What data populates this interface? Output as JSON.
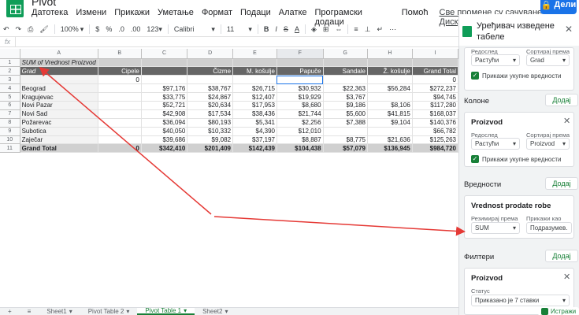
{
  "app": {
    "title": "Pivot",
    "share_label": "Дели",
    "save_status": "Све промене су сачуване на Диску"
  },
  "menu": [
    "Датотека",
    "Измени",
    "Прикажи",
    "Уметање",
    "Формат",
    "Подаци",
    "Алатке",
    "Програмски додаци",
    "Помоћ"
  ],
  "toolbar": {
    "zoom": "100%",
    "currency": "$",
    "percent": "%",
    "dec1": ".0",
    "dec2": ".00",
    "fmt": "123▾",
    "font": "Calibri",
    "size": "11",
    "bold": "B",
    "italic": "I",
    "strike": "S",
    "color": "A"
  },
  "formula": {
    "fx": "fx"
  },
  "columns": [
    "A",
    "B",
    "C",
    "D",
    "E",
    "F",
    "G",
    "H",
    "I"
  ],
  "rows": [
    [
      "SUM of Vrednost Proizvod",
      "",
      "",
      "",
      "",
      "",
      "",
      "",
      ""
    ],
    [
      "Grad",
      "Cipele",
      "",
      "Čizme",
      "M. košulje",
      "Papuče",
      "Sandale",
      "Ž. košulje",
      "Grand Total"
    ],
    [
      "",
      "0",
      "",
      "",
      "",
      "",
      "",
      "",
      "0"
    ],
    [
      "Beograd",
      "",
      "$97,176",
      "$38,767",
      "$26,715",
      "$30,932",
      "$22,363",
      "$56,284",
      "$272,237"
    ],
    [
      "Kragujevac",
      "",
      "$33,775",
      "$24,867",
      "$12,407",
      "$19,929",
      "$3,767",
      "",
      "$94,745"
    ],
    [
      "Novi Pazar",
      "",
      "$52,721",
      "$20,634",
      "$17,953",
      "$8,680",
      "$9,186",
      "$8,106",
      "$117,280"
    ],
    [
      "Novi Sad",
      "",
      "$42,908",
      "$17,534",
      "$38,436",
      "$21,744",
      "$5,600",
      "$41,815",
      "$168,037"
    ],
    [
      "Požarevac",
      "",
      "$36,094",
      "$80,193",
      "$5,341",
      "$2,256",
      "$7,388",
      "$9,104",
      "$140,376"
    ],
    [
      "Subotica",
      "",
      "$40,050",
      "$10,332",
      "$4,390",
      "$12,010",
      "",
      "",
      "$66,782"
    ],
    [
      "Zaječar",
      "",
      "$39,686",
      "$9,082",
      "$37,197",
      "$8,887",
      "$8,775",
      "$21,636",
      "$125,263"
    ],
    [
      "Grand Total",
      "0",
      "$342,410",
      "$201,409",
      "$142,439",
      "$104,438",
      "$57,079",
      "$136,945",
      "$984,720"
    ]
  ],
  "sheets": [
    "Sheet1",
    "Pivot Table 2",
    "Pivot Table 1",
    "Sheet2"
  ],
  "active_sheet": "Pivot Table 1",
  "explore_label": "Истражи",
  "panel": {
    "title": "Уређивач изведене табеле",
    "rows_card": {
      "order_label": "Редослед",
      "order_value": "Растући",
      "sort_label": "Сортирај према",
      "sort_value": "Grad",
      "totals_label": "Прикажи укупне вредности"
    },
    "columns_section": "Колоне",
    "add_label": "Додај",
    "columns_card": {
      "title": "Proizvod",
      "order_label": "Редослед",
      "order_value": "Растући",
      "sort_label": "Сортирај према",
      "sort_value": "Proizvod",
      "totals_label": "Прикажи укупне вредности"
    },
    "values_section": "Вредности",
    "values_card": {
      "title": "Vrednost prodate robe",
      "summarize_label": "Резимирај према",
      "summarize_value": "SUM",
      "show_label": "Прикажи као",
      "show_value": "Подразумев..."
    },
    "filters_section": "Филтери",
    "filters_card": {
      "title": "Proizvod",
      "status_label": "Статус",
      "status_value": "Приказано је 7 ставки"
    }
  },
  "colors": {
    "accent": "#188038",
    "annotation": "#e53935",
    "selection": "#1a73e8"
  }
}
